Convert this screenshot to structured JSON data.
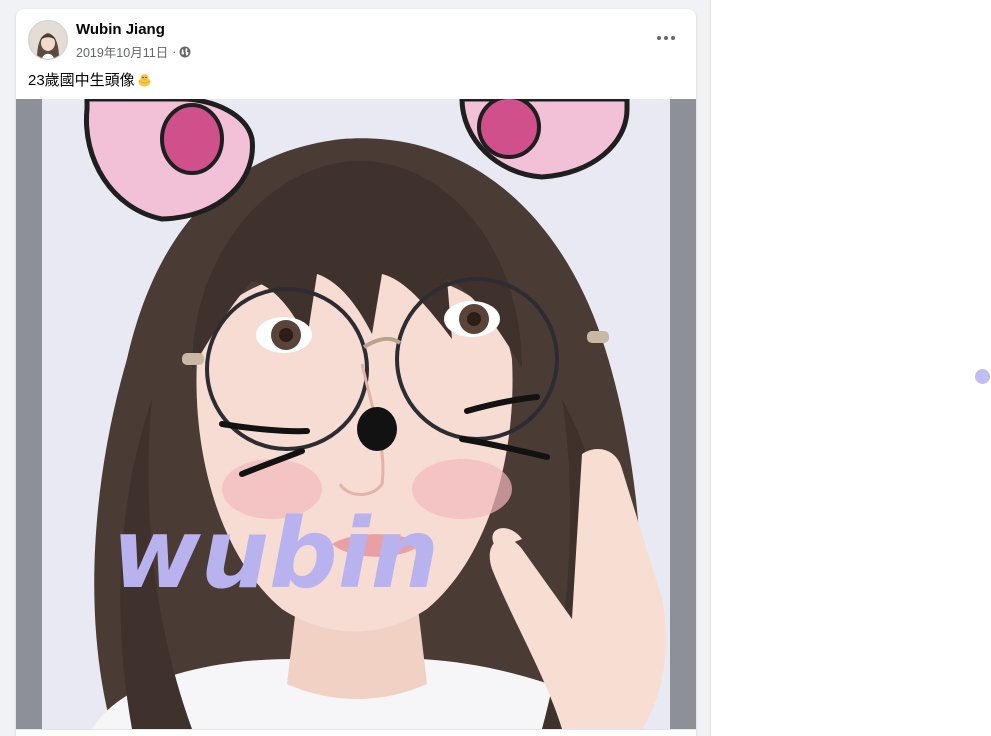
{
  "post": {
    "author_name": "Wubin Jiang",
    "date": "2019年10月11日",
    "separator": "·",
    "privacy_icon": "globe-icon",
    "more_icon": "more-horizontal-icon",
    "text": "23歲國中生頭像",
    "text_emoji": "baby-chick-emoji"
  },
  "photo": {
    "overlay_text": "wubin",
    "overlay_color": "#b8b2ef"
  },
  "colors": {
    "feed_background": "#f0f2f5",
    "secondary_text": "#65676b",
    "indicator_dot": "#c2bdf2"
  }
}
